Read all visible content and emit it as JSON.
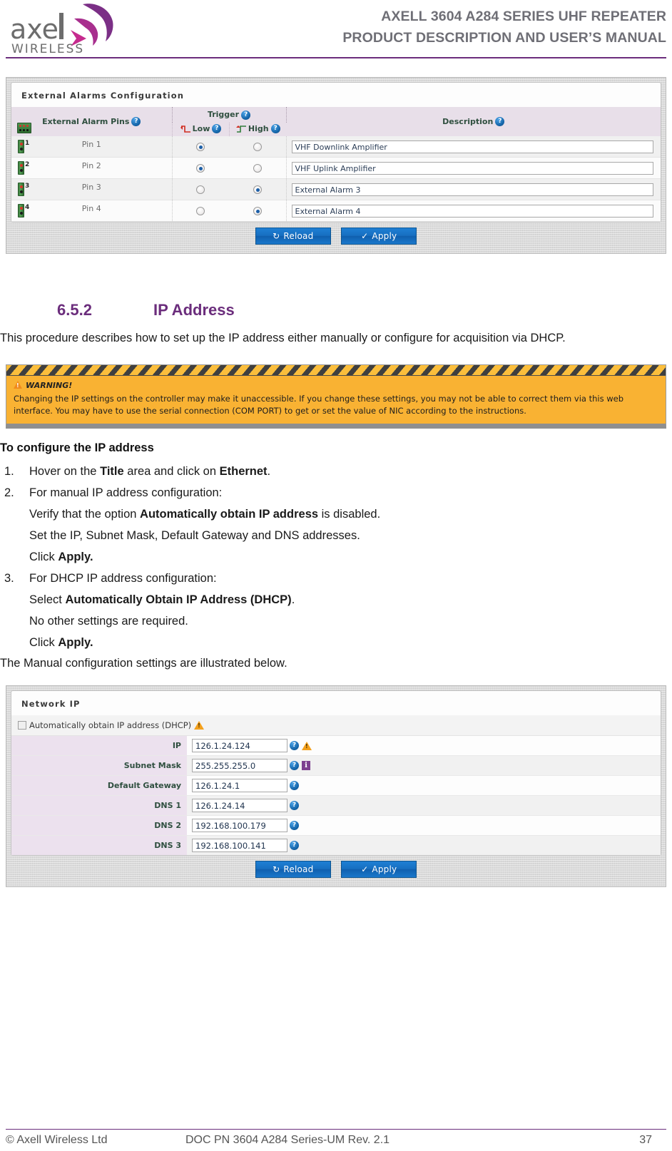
{
  "header": {
    "logo_word": "axell",
    "logo_sub": "WIRELESS",
    "title_line1": "AXELL 3604 A284 SERIES UHF REPEATER",
    "title_line2": "PRODUCT DESCRIPTION AND USER’S MANUAL",
    "accent_color": "#6b2d7c"
  },
  "alarms_panel": {
    "panel_title": "External Alarms Configuration",
    "columns": {
      "pins": "External Alarm Pins",
      "trigger": "Trigger",
      "low": "Low",
      "high": "High",
      "description": "Description"
    },
    "rows": [
      {
        "pin_num": "1",
        "pin_label": "Pin 1",
        "low_selected": true,
        "high_selected": false,
        "description": "VHF Downlink Amplifier"
      },
      {
        "pin_num": "2",
        "pin_label": "Pin 2",
        "low_selected": true,
        "high_selected": false,
        "description": "VHF Uplink Amplifier"
      },
      {
        "pin_num": "3",
        "pin_label": "Pin 3",
        "low_selected": false,
        "high_selected": true,
        "description": "External Alarm 3"
      },
      {
        "pin_num": "4",
        "pin_label": "Pin 4",
        "low_selected": false,
        "high_selected": true,
        "description": "External Alarm 4"
      }
    ],
    "buttons": {
      "reload": "Reload",
      "apply": "Apply"
    }
  },
  "section": {
    "number": "6.5.2",
    "title": "IP Address",
    "intro": "This procedure describes how to set up the IP address either manually or configure for acquisition via DHCP."
  },
  "warning": {
    "title": "WARNING!",
    "text": "Changing the IP settings on the controller may make it unaccessible. If you change these settings, you may not be able to correct them via this web interface. You may have to use the serial connection (COM PORT) to get or set the value of NIC according to the instructions."
  },
  "procedure": {
    "heading": "To configure the IP address",
    "steps": [
      {
        "marker": "1.",
        "parts": [
          {
            "text": "Hover on the ",
            "bold": false
          },
          {
            "text": "Title",
            "bold": true
          },
          {
            "text": " area and click on ",
            "bold": false
          },
          {
            "text": "Ethernet",
            "bold": true
          },
          {
            "text": ".",
            "bold": false
          }
        ],
        "sub": []
      },
      {
        "marker": "2.",
        "parts": [
          {
            "text": "For manual IP address configuration:",
            "bold": false
          }
        ],
        "sub": [
          [
            {
              "text": "Verify that the option ",
              "bold": false
            },
            {
              "text": "Automatically obtain IP address",
              "bold": true
            },
            {
              "text": " is disabled.",
              "bold": false
            }
          ],
          [
            {
              "text": "Set the IP, Subnet Mask, Default Gateway and DNS addresses.",
              "bold": false
            }
          ],
          [
            {
              "text": "Click ",
              "bold": false
            },
            {
              "text": "Apply.",
              "bold": true
            }
          ]
        ]
      },
      {
        "marker": "3.",
        "parts": [
          {
            "text": "For DHCP IP address configuration:",
            "bold": false
          }
        ],
        "sub": [
          [
            {
              "text": "Select ",
              "bold": false
            },
            {
              "text": "Automatically Obtain IP Address (DHCP)",
              "bold": true
            },
            {
              "text": ".",
              "bold": false
            }
          ],
          [
            {
              "text": "No other settings are required.",
              "bold": false
            }
          ],
          [
            {
              "text": "Click ",
              "bold": false
            },
            {
              "text": "Apply.",
              "bold": true
            }
          ]
        ]
      }
    ],
    "closing": "The Manual configuration settings are illustrated below."
  },
  "network_panel": {
    "panel_title": "Network IP",
    "dhcp_label": "Automatically obtain IP address (DHCP)",
    "dhcp_checked": false,
    "fields": [
      {
        "label": "IP",
        "value": "126.1.24.124",
        "has_help": true,
        "has_warn": true,
        "has_info": false
      },
      {
        "label": "Subnet Mask",
        "value": "255.255.255.0",
        "has_help": true,
        "has_warn": false,
        "has_info": true
      },
      {
        "label": "Default Gateway",
        "value": "126.1.24.1",
        "has_help": true,
        "has_warn": false,
        "has_info": false
      },
      {
        "label": "DNS 1",
        "value": "126.1.24.14",
        "has_help": true,
        "has_warn": false,
        "has_info": false
      },
      {
        "label": "DNS 2",
        "value": "192.168.100.179",
        "has_help": true,
        "has_warn": false,
        "has_info": false
      },
      {
        "label": "DNS 3",
        "value": "192.168.100.141",
        "has_help": true,
        "has_warn": false,
        "has_info": false
      }
    ],
    "buttons": {
      "reload": "Reload",
      "apply": "Apply"
    }
  },
  "footer": {
    "copyright": "© Axell Wireless Ltd",
    "doc": "DOC PN 3604 A284 Series-UM Rev. 2.1",
    "page": "37"
  }
}
